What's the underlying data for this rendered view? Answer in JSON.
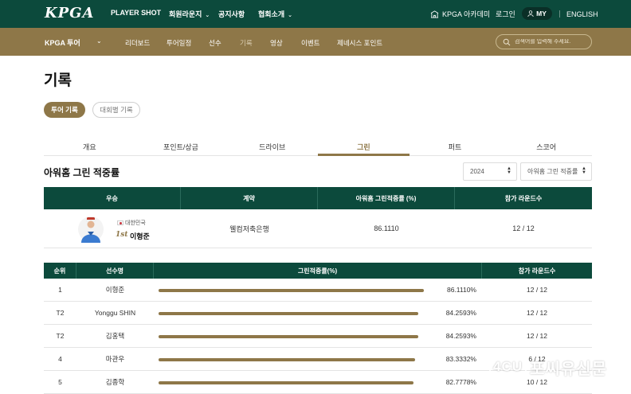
{
  "header": {
    "logo": "KPGA",
    "nav": [
      "PLAYER SHOT",
      "회원라운지",
      "공지사항",
      "협회소개"
    ],
    "academy": "KPGA 아카데미",
    "login": "로그인",
    "my": "MY",
    "english": "ENGLISH"
  },
  "subnav": {
    "tour": "KPGA 투어",
    "items": [
      "리더보드",
      "투어일정",
      "선수",
      "기록",
      "영상",
      "이벤트",
      "제네시스 포인트"
    ],
    "active_index": 3,
    "search_placeholder": "검색어를 입력해 주세요."
  },
  "page": {
    "title": "기록",
    "pill_active": "투어 기록",
    "pill_inactive": "대회별 기록"
  },
  "tabs": [
    "개요",
    "포인트/상금",
    "드라이브",
    "그린",
    "퍼트",
    "스코어"
  ],
  "active_tab": 3,
  "section": {
    "title": "아워홈 그린 적중률",
    "year": "2024",
    "category": "아워홈 그린 적중률"
  },
  "winner_table": {
    "headers": [
      "우승",
      "계약",
      "아워홈 그린적중률 (%)",
      "참가 라운드수"
    ],
    "row": {
      "country": "대한민국",
      "rank": "1st",
      "name": "이형준",
      "sponsor": "웰컴저축은행",
      "rate": "86.1110",
      "rounds": "12 / 12"
    }
  },
  "rank_table": {
    "headers": [
      "순위",
      "선수명",
      "그린적중률(%)",
      "참가 라운드수"
    ],
    "rows": [
      {
        "rank": "1",
        "name": "이형준",
        "pct": "86.1110%",
        "value": 86.111,
        "rounds": "12 / 12"
      },
      {
        "rank": "T2",
        "name": "Yonggu SHIN",
        "pct": "84.2593%",
        "value": 84.2593,
        "rounds": "12 / 12"
      },
      {
        "rank": "T2",
        "name": "김홍택",
        "pct": "84.2593%",
        "value": 84.2593,
        "rounds": "12 / 12"
      },
      {
        "rank": "4",
        "name": "마관우",
        "pct": "83.3332%",
        "value": 83.3332,
        "rounds": "6 / 12"
      },
      {
        "rank": "5",
        "name": "김종학",
        "pct": "82.7778%",
        "value": 82.7778,
        "rounds": "10 / 12"
      }
    ]
  },
  "watermark": {
    "box": "4CU",
    "text": "포씨유신문"
  },
  "colors": {
    "green": "#0c4a3c",
    "gold": "#8e7748"
  }
}
